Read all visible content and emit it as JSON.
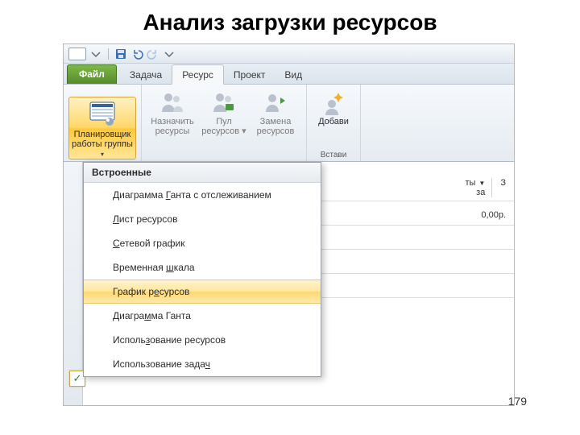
{
  "slide_title": "Анализ загрузки ресурсов",
  "page_number": "179",
  "tabs": {
    "file": "Файл",
    "task": "Задача",
    "resource": "Ресурс",
    "project": "Проект",
    "view": "Вид"
  },
  "ribbon": {
    "team_planner": {
      "line1": "Планировщик",
      "line2": "работы группы"
    },
    "assign": {
      "line1": "Назначить",
      "line2": "ресурсы"
    },
    "pool": {
      "line1": "Пул",
      "line2": "ресурсов"
    },
    "substitute": {
      "line1": "Замена",
      "line2": "ресурсов"
    },
    "add": {
      "line1": "Добави",
      "line2": ""
    },
    "group_insert": "Встави"
  },
  "dropdown": {
    "header": "Встроенные",
    "items": [
      {
        "pre": "Диаграмма ",
        "u": "Г",
        "post": "анта с отслеживанием",
        "checked": false
      },
      {
        "pre": "",
        "u": "Л",
        "post": "ист ресурсов",
        "checked": false
      },
      {
        "pre": "",
        "u": "С",
        "post": "етевой график",
        "checked": false
      },
      {
        "pre": "Временная ",
        "u": "ш",
        "post": "кала",
        "checked": false
      },
      {
        "pre": "График р",
        "u": "е",
        "post": "сурсов",
        "checked": false,
        "hover": true
      },
      {
        "pre": "Диагра",
        "u": "м",
        "post": "ма Ганта",
        "checked": false
      },
      {
        "pre": "Исполь",
        "u": "з",
        "post": "ование ресурсов",
        "checked": true
      },
      {
        "pre": "Использование зада",
        "u": "ч",
        "post": "",
        "checked": false
      }
    ]
  },
  "grid": {
    "colfrag1": "ты",
    "colfrag2": "за",
    "sample_value": "0,00р.",
    "extra_col": "З"
  }
}
